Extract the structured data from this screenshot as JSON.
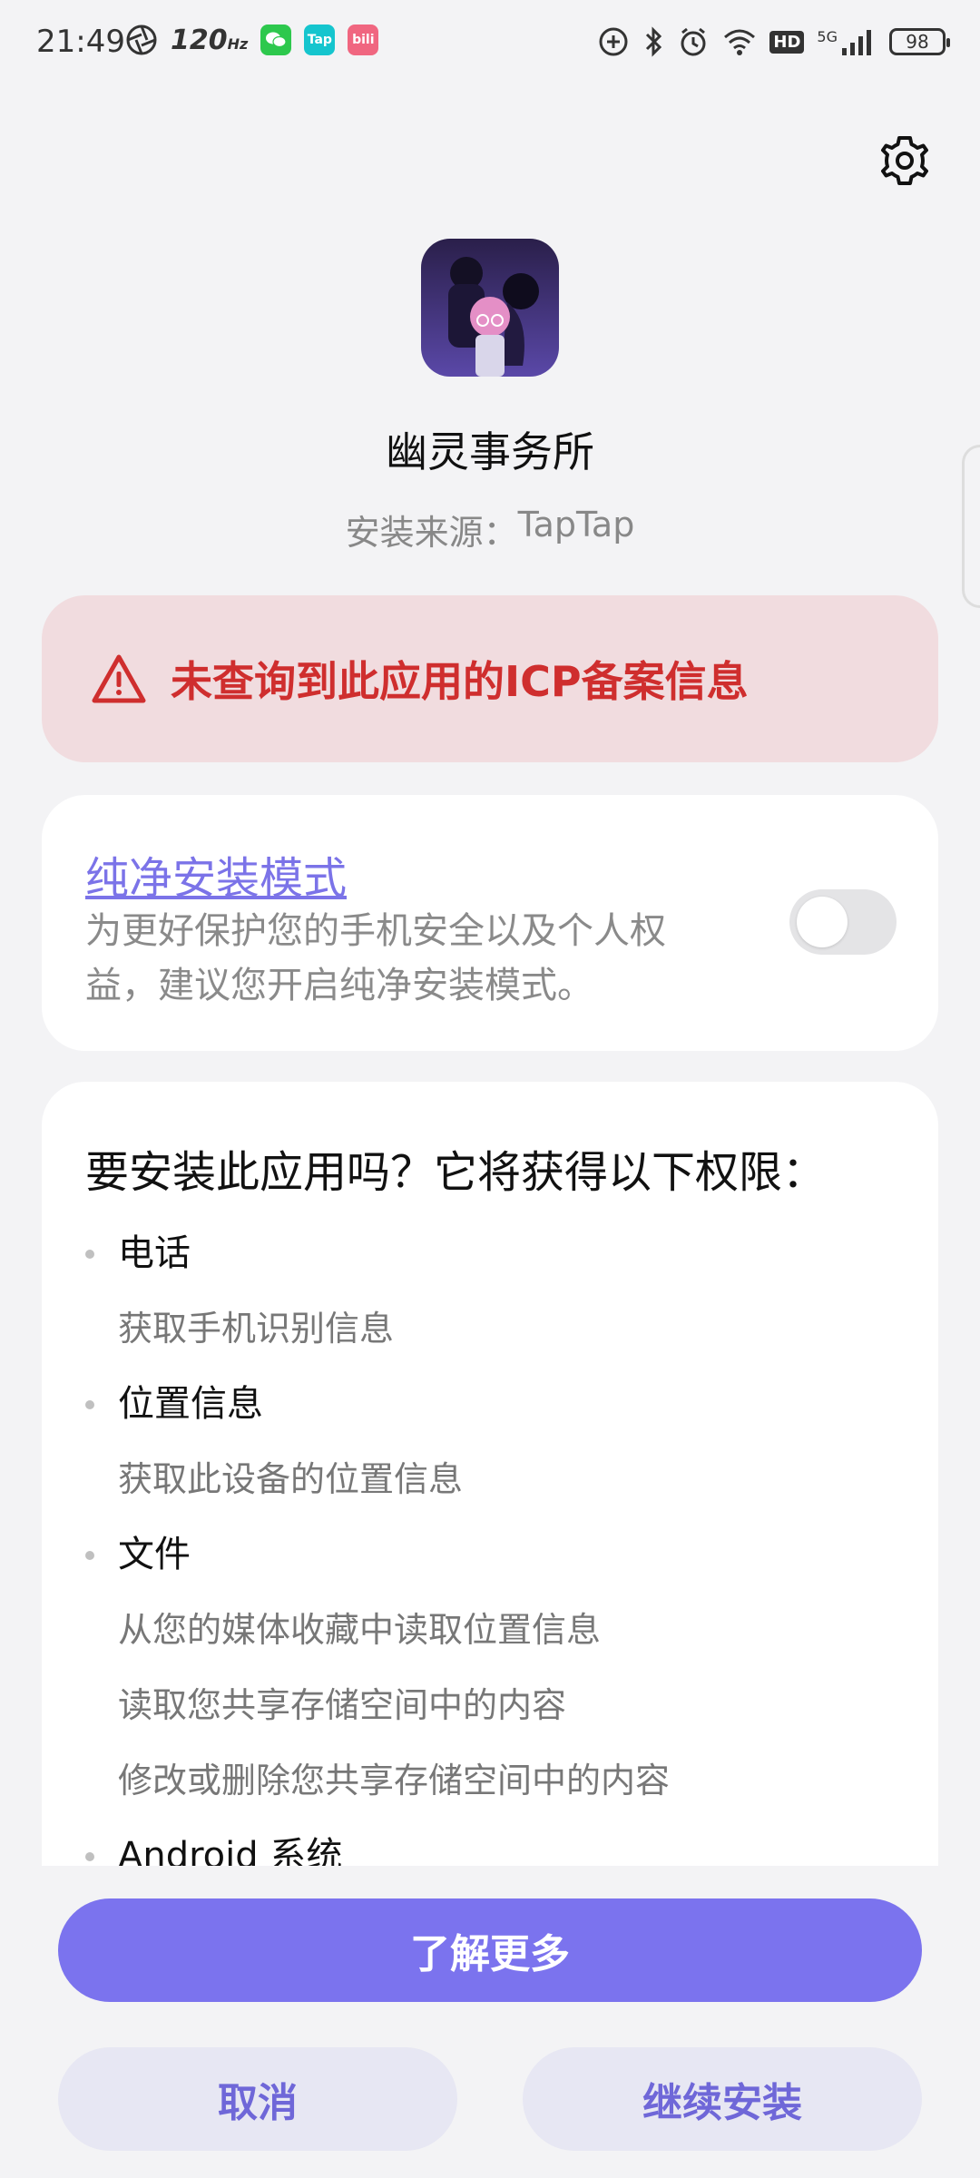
{
  "status_bar": {
    "time": "21:49",
    "refresh_rate": "120",
    "app_icons": [
      {
        "name": "wechat",
        "label": "",
        "color": "#2dc84d"
      },
      {
        "name": "taptap",
        "label": "Tap",
        "color": "#15c5ce"
      },
      {
        "name": "bilibili",
        "label": "bili",
        "color": "#f06680"
      }
    ],
    "network": "5G",
    "hd": "HD",
    "battery": "98"
  },
  "header": {
    "app_name": "幽灵事务所",
    "source_label": "安装来源：",
    "source_value": "TapTap"
  },
  "warning": {
    "text": "未查询到此应用的ICP备案信息",
    "color": "#cf2e2e",
    "background": "#f1dcdf"
  },
  "pure_mode": {
    "title": "纯净安装模式",
    "description": "为更好保护您的手机安全以及个人权益，建议您开启纯净安装模式。",
    "enabled": false
  },
  "permissions": {
    "question": "要安装此应用吗？它将获得以下权限：",
    "groups": [
      {
        "title": "电话",
        "items": [
          "获取手机识别信息"
        ]
      },
      {
        "title": "位置信息",
        "items": [
          "获取此设备的位置信息"
        ]
      },
      {
        "title": "文件",
        "items": [
          "从您的媒体收藏中读取位置信息",
          "读取您共享存储空间中的内容",
          "修改或删除您共享存储空间中的内容"
        ]
      },
      {
        "title": "Android 系统",
        "items": []
      }
    ]
  },
  "actions": {
    "learn_more": "了解更多",
    "cancel": "取消",
    "continue": "继续安装"
  },
  "colors": {
    "accent": "#7b73ee",
    "secondary_button_bg": "#e7e7f3",
    "background": "#f3f3f5"
  }
}
